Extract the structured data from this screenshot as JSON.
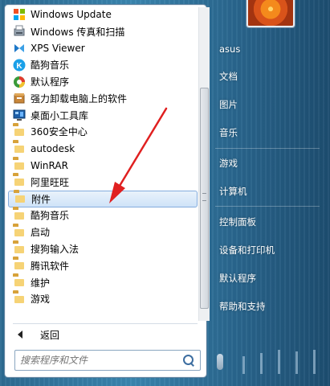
{
  "programs": [
    {
      "label": "Windows Update",
      "icon": "windows-update-icon"
    },
    {
      "label": "Windows 传真和扫描",
      "icon": "fax-scan-icon"
    },
    {
      "label": "XPS Viewer",
      "icon": "xps-viewer-icon"
    },
    {
      "label": "酷狗音乐",
      "icon": "kugou-icon"
    },
    {
      "label": "默认程序",
      "icon": "default-programs-icon"
    },
    {
      "label": "强力卸载电脑上的软件",
      "icon": "uninstall-icon"
    },
    {
      "label": "桌面小工具库",
      "icon": "gadgets-icon"
    },
    {
      "label": "360安全中心",
      "icon": "folder-icon"
    },
    {
      "label": "autodesk",
      "icon": "folder-icon"
    },
    {
      "label": "WinRAR",
      "icon": "folder-icon"
    },
    {
      "label": "阿里旺旺",
      "icon": "folder-icon"
    },
    {
      "label": "附件",
      "icon": "folder-icon",
      "selected": true
    },
    {
      "label": "酷狗音乐",
      "icon": "folder-icon"
    },
    {
      "label": "启动",
      "icon": "folder-icon"
    },
    {
      "label": "搜狗输入法",
      "icon": "folder-icon"
    },
    {
      "label": "腾讯软件",
      "icon": "folder-icon"
    },
    {
      "label": "维护",
      "icon": "folder-icon"
    },
    {
      "label": "游戏",
      "icon": "folder-icon"
    }
  ],
  "back": {
    "label": "返回"
  },
  "search": {
    "placeholder": "搜索程序和文件"
  },
  "right_menu": {
    "user": "asus",
    "documents": "文档",
    "pictures": "图片",
    "music": "音乐",
    "games": "游戏",
    "computer": "计算机",
    "control_panel": "控制面板",
    "devices_printers": "设备和打印机",
    "default_programs": "默认程序",
    "help_support": "帮助和支持"
  },
  "colors": {
    "selection": "#cfe3f8",
    "selection_border": "#84acdd",
    "arrow": "#e02020",
    "glass": "#3a86b0"
  }
}
